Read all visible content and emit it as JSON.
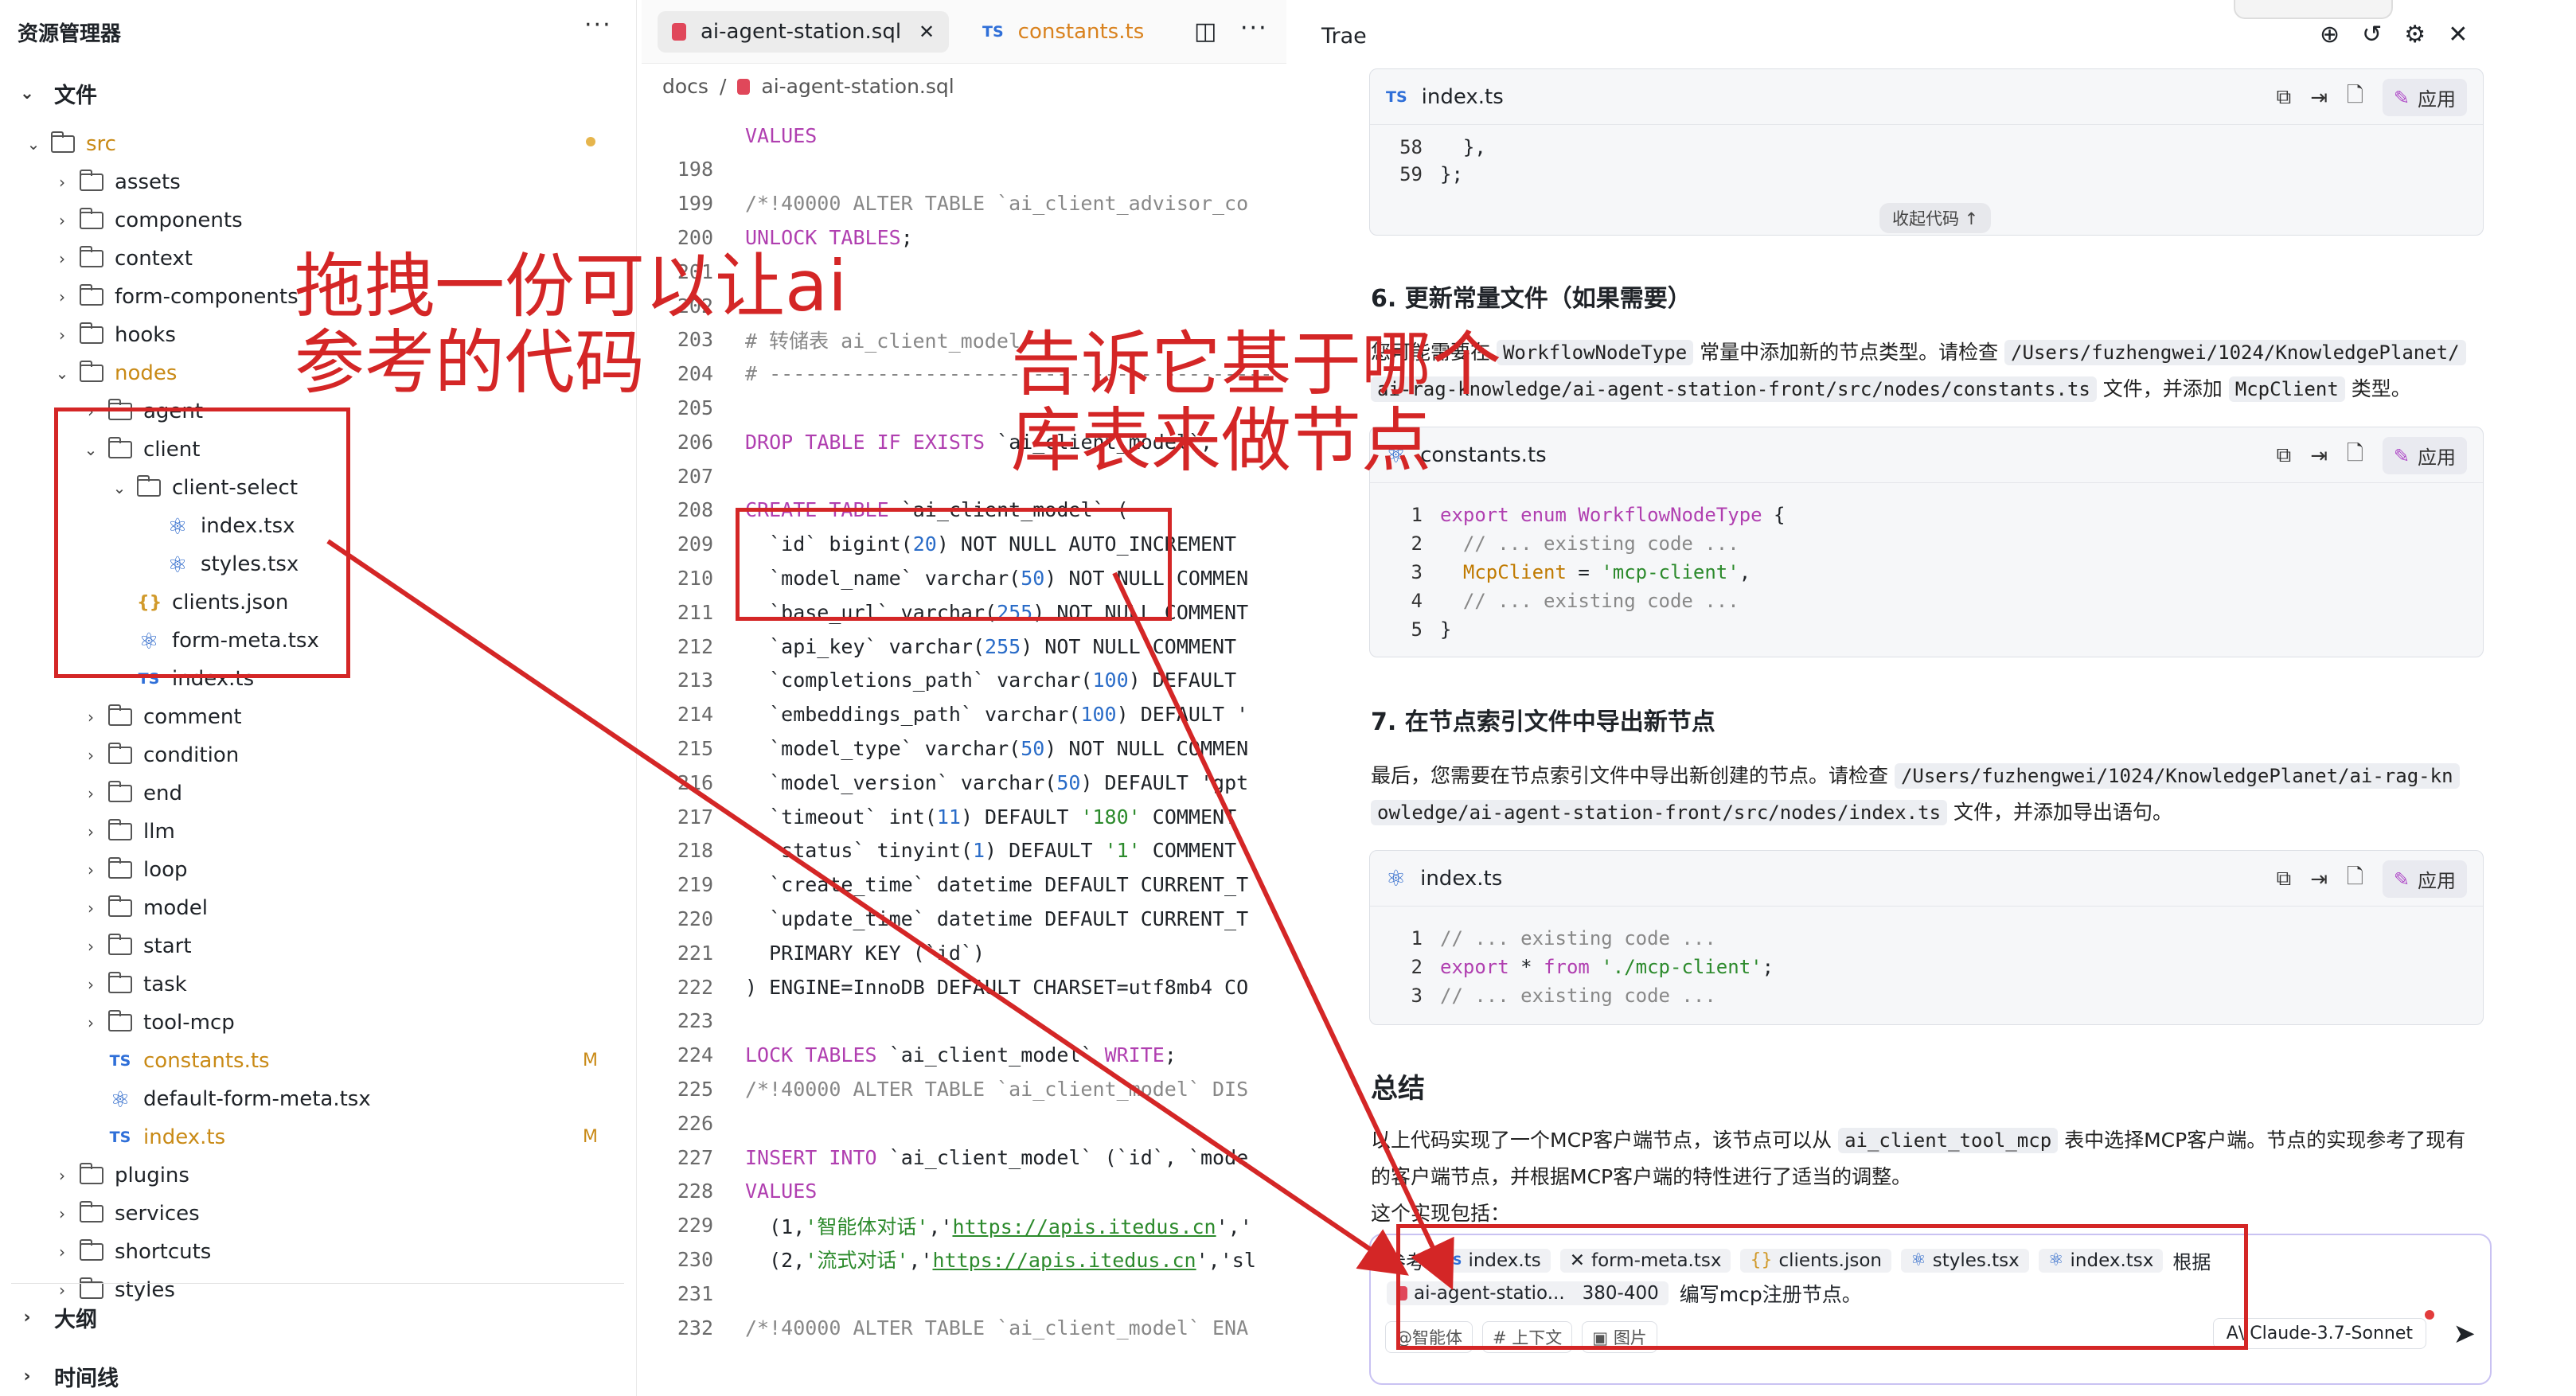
{
  "explorer": {
    "title": "资源管理器",
    "more": "···",
    "files_section": "文件",
    "outline_section": "大纲",
    "timeline_section": "时间线",
    "rows": [
      {
        "label": "src",
        "type": "folder",
        "open": true,
        "level": 0,
        "color": "mod"
      },
      {
        "label": "assets",
        "type": "folder",
        "level": 1
      },
      {
        "label": "components",
        "type": "folder",
        "level": 1
      },
      {
        "label": "context",
        "type": "folder",
        "level": 1
      },
      {
        "label": "form-components",
        "type": "folder",
        "level": 1
      },
      {
        "label": "hooks",
        "type": "folder",
        "level": 1
      },
      {
        "label": "nodes",
        "type": "folder",
        "open": true,
        "level": 1,
        "color": "mod"
      },
      {
        "label": "agent",
        "type": "folder",
        "level": 2
      },
      {
        "label": "client",
        "type": "folder",
        "open": true,
        "level": 2
      },
      {
        "label": "client-select",
        "type": "folder",
        "open": true,
        "level": 3
      },
      {
        "label": "index.tsx",
        "type": "react",
        "level": 4
      },
      {
        "label": "styles.tsx",
        "type": "react",
        "level": 4
      },
      {
        "label": "clients.json",
        "type": "json",
        "level": 3
      },
      {
        "label": "form-meta.tsx",
        "type": "react",
        "level": 3
      },
      {
        "label": "index.ts",
        "type": "ts",
        "level": 3
      },
      {
        "label": "comment",
        "type": "folder",
        "level": 2
      },
      {
        "label": "condition",
        "type": "folder",
        "level": 2
      },
      {
        "label": "end",
        "type": "folder",
        "level": 2
      },
      {
        "label": "llm",
        "type": "folder",
        "level": 2
      },
      {
        "label": "loop",
        "type": "folder",
        "level": 2
      },
      {
        "label": "model",
        "type": "folder",
        "level": 2
      },
      {
        "label": "start",
        "type": "folder",
        "level": 2
      },
      {
        "label": "task",
        "type": "folder",
        "level": 2
      },
      {
        "label": "tool-mcp",
        "type": "folder",
        "level": 2
      },
      {
        "label": "constants.ts",
        "type": "ts",
        "level": 2,
        "color": "mod",
        "badge": "M"
      },
      {
        "label": "default-form-meta.tsx",
        "type": "react",
        "level": 2
      },
      {
        "label": "index.ts",
        "type": "ts",
        "level": 2,
        "color": "mod",
        "badge": "M"
      },
      {
        "label": "plugins",
        "type": "folder",
        "level": 1
      },
      {
        "label": "services",
        "type": "folder",
        "level": 1
      },
      {
        "label": "shortcuts",
        "type": "folder",
        "level": 1
      },
      {
        "label": "styles",
        "type": "folder",
        "level": 1
      }
    ]
  },
  "editor": {
    "tabs": [
      {
        "label": "ai-agent-station.sql",
        "active": true
      },
      {
        "label": "constants.ts",
        "active": false
      }
    ],
    "breadcrumb": {
      "folder": "docs",
      "sep": "/",
      "file": "ai-agent-station.sql"
    },
    "lines": [
      {
        "n": "",
        "code": "VALUES"
      },
      {
        "n": "198",
        "code": ""
      },
      {
        "n": "199",
        "code": "/*!40000 ALTER TABLE `ai_client_advisor_co"
      },
      {
        "n": "200",
        "code": "UNLOCK TABLES;"
      },
      {
        "n": "201",
        "code": ""
      },
      {
        "n": "202",
        "code": ""
      },
      {
        "n": "203",
        "code": "# 转储表 ai_client_model"
      },
      {
        "n": "204",
        "code": "# ------------------------------------------"
      },
      {
        "n": "205",
        "code": ""
      },
      {
        "n": "206",
        "code": "DROP TABLE IF EXISTS `ai_client_model`;"
      },
      {
        "n": "207",
        "code": ""
      },
      {
        "n": "208",
        "code": "CREATE TABLE `ai_client_model` ("
      },
      {
        "n": "209",
        "code": "  `id` bigint(20) NOT NULL AUTO_INCREMENT"
      },
      {
        "n": "210",
        "code": "  `model_name` varchar(50) NOT NULL COMMEN"
      },
      {
        "n": "211",
        "code": "  `base_url` varchar(255) NOT NULL COMMENT"
      },
      {
        "n": "212",
        "code": "  `api_key` varchar(255) NOT NULL COMMENT"
      },
      {
        "n": "213",
        "code": "  `completions_path` varchar(100) DEFAULT"
      },
      {
        "n": "214",
        "code": "  `embeddings_path` varchar(100) DEFAULT '"
      },
      {
        "n": "215",
        "code": "  `model_type` varchar(50) NOT NULL COMMEN"
      },
      {
        "n": "216",
        "code": "  `model_version` varchar(50) DEFAULT 'gpt"
      },
      {
        "n": "217",
        "code": "  `timeout` int(11) DEFAULT '180' COMMENT"
      },
      {
        "n": "218",
        "code": "  `status` tinyint(1) DEFAULT '1' COMMENT"
      },
      {
        "n": "219",
        "code": "  `create_time` datetime DEFAULT CURRENT_T"
      },
      {
        "n": "220",
        "code": "  `update_time` datetime DEFAULT CURRENT_T"
      },
      {
        "n": "221",
        "code": "  PRIMARY KEY (`id`)"
      },
      {
        "n": "222",
        "code": ") ENGINE=InnoDB DEFAULT CHARSET=utf8mb4 CO"
      },
      {
        "n": "223",
        "code": ""
      },
      {
        "n": "224",
        "code": "LOCK TABLES `ai_client_model` WRITE;"
      },
      {
        "n": "225",
        "code": "/*!40000 ALTER TABLE `ai_client_model` DIS"
      },
      {
        "n": "226",
        "code": ""
      },
      {
        "n": "227",
        "code": "INSERT INTO `ai_client_model` (`id`, `mode"
      },
      {
        "n": "228",
        "code": "VALUES"
      },
      {
        "n": "229",
        "code": "  (1,'智能体对话','https://apis.itedus.cn','"
      },
      {
        "n": "230",
        "code": "  (2,'流式对话','https://apis.itedus.cn','sl"
      },
      {
        "n": "231",
        "code": ""
      },
      {
        "n": "232",
        "code": "/*!40000 ALTER TABLE `ai_client_model` ENA"
      }
    ]
  },
  "chat": {
    "title": "Trae",
    "block1": {
      "file": "index.ts",
      "lines": [
        {
          "n": "58",
          "code": "  },"
        },
        {
          "n": "59",
          "code": "};"
        }
      ],
      "collapse": "收起代码 ↑"
    },
    "apply_label": "应用",
    "section6": {
      "heading": "6. 更新常量文件（如果需要）",
      "p1a": "您可能需要在 ",
      "code1": "WorkflowNodeType",
      "p1b": " 常量中添加新的节点类型。请检查 ",
      "code2": "/Users/fuzhengwei/1024/KnowledgePlanet/",
      "code3": "ai-rag-knowledge/ai-agent-station-front/src/nodes/constants.ts",
      "p1c": " 文件，并添加 ",
      "code4": "McpClient",
      "p1d": " 类型。"
    },
    "block2": {
      "file": "constants.ts",
      "lines": [
        {
          "n": "1",
          "code": "export enum WorkflowNodeType {"
        },
        {
          "n": "2",
          "code": "  // ... existing code ..."
        },
        {
          "n": "3",
          "code": "  McpClient = 'mcp-client',"
        },
        {
          "n": "4",
          "code": "  // ... existing code ..."
        },
        {
          "n": "5",
          "code": "}"
        }
      ]
    },
    "section7": {
      "heading": "7. 在节点索引文件中导出新节点",
      "p1a": "最后，您需要在节点索引文件中导出新创建的节点。请检查 ",
      "code1": "/Users/fuzhengwei/1024/KnowledgePlanet/ai-rag-kn",
      "code2": "owledge/ai-agent-station-front/src/nodes/index.ts",
      "p1b": " 文件，并添加导出语句。"
    },
    "block3": {
      "file": "index.ts",
      "lines": [
        {
          "n": "1",
          "code": "// ... existing code ..."
        },
        {
          "n": "2",
          "code": "export * from './mcp-client';"
        },
        {
          "n": "3",
          "code": "// ... existing code ..."
        }
      ]
    },
    "summary": {
      "heading": "总结",
      "p1a": "以上代码实现了一个MCP客户端节点，该节点可以从 ",
      "code1": "ai_client_tool_mcp",
      "p1b": " 表中选择MCP客户端。节点的实现参考了现有",
      "p2": "的客户端节点，并根据MCP客户端的特性进行了适当的调整。",
      "p3": "这个实现包括："
    },
    "input": {
      "prefix": "参考",
      "chips": [
        "index.ts",
        "form-meta.tsx",
        "clients.json",
        "styles.tsx",
        "index.tsx"
      ],
      "suffix": "根据",
      "file_chip": "ai-agent-statio...",
      "range": "380-400",
      "text": "编写mcp注册节点。",
      "btn_agent": "@智能体",
      "btn_context": "# 上下文",
      "btn_image": "图片",
      "model": "Claude-3.7-Sonnet"
    }
  },
  "annotations": {
    "left_note": [
      "拖拽一份可以让ai",
      "参考的代码"
    ],
    "right_note": [
      "告诉它基于哪个",
      "库表来做节点"
    ]
  },
  "colors": {
    "accent": "#d42626",
    "modified": "#c98a16",
    "apply_wand": "#b04dc8"
  }
}
